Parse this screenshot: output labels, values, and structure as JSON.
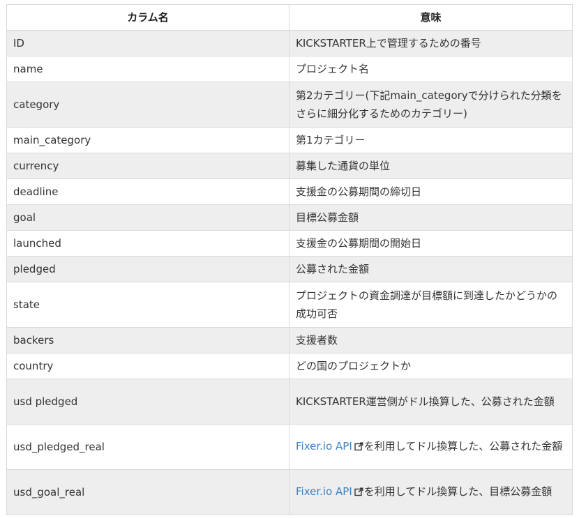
{
  "header": {
    "col1": "カラム名",
    "col2": "意味"
  },
  "rows": [
    {
      "name": "ID",
      "meaning": "KICKSTARTER上で管理するための番号"
    },
    {
      "name": "name",
      "meaning": "プロジェクト名"
    },
    {
      "name": "category",
      "meaning": "第2カテゴリー(下記main_categoryで分けられた分類をさらに細分化するためのカテゴリー)"
    },
    {
      "name": "main_category",
      "meaning": "第1カテゴリー"
    },
    {
      "name": "currency",
      "meaning": "募集した通貨の単位"
    },
    {
      "name": "deadline",
      "meaning": "支援金の公募期間の締切日"
    },
    {
      "name": "goal",
      "meaning": "目標公募金額"
    },
    {
      "name": "launched",
      "meaning": "支援金の公募期間の開始日"
    },
    {
      "name": "pledged",
      "meaning": "公募された金額"
    },
    {
      "name": "state",
      "meaning": "プロジェクトの資金調達が目標額に到達したかどうかの成功可否"
    },
    {
      "name": "backers",
      "meaning": "支援者数"
    },
    {
      "name": "country",
      "meaning": "どの国のプロジェクトか"
    },
    {
      "name": "usd pledged",
      "meaning": "KICKSTARTER運営側がドル換算した、公募された金額"
    },
    {
      "name": "usd_pledged_real",
      "link": "Fixer.io API",
      "meaning": "を利用してドル換算した、公募された金額"
    },
    {
      "name": "usd_goal_real",
      "link": "Fixer.io API",
      "meaning": "を利用してドル換算した、目標公募金額"
    }
  ],
  "icons": {
    "external_link": "external-link-icon"
  },
  "colors": {
    "link": "#3b82c4",
    "stripe": "#eeeeee",
    "border": "#d9d9d9"
  }
}
